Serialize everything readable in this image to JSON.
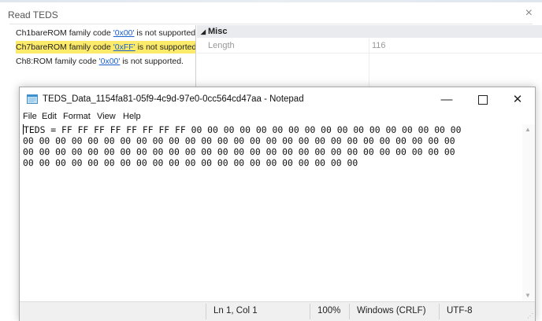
{
  "read_teds_window": {
    "title": "Read TEDS",
    "close_glyph": "×"
  },
  "messages": [
    {
      "prefix": "Ch1bareROM family code ",
      "code": "'0x00'",
      "suffix": " is not supported.",
      "selected": false
    },
    {
      "prefix": "Ch7bareROM family code ",
      "code": "'0xFF'",
      "suffix": " is not supported.",
      "selected": true
    },
    {
      "prefix": "Ch8:ROM family code ",
      "code": "'0x00'",
      "suffix": " is not supported.",
      "selected": false
    }
  ],
  "property_grid": {
    "category_arrow": "◢",
    "category": "Misc",
    "rows": [
      {
        "name": "Length",
        "value": "116"
      }
    ]
  },
  "notepad": {
    "title": "TEDS_Data_1154fa81-05f9-4c9d-97e0-0cc564cd47aa - Notepad",
    "min_glyph": "—",
    "close_glyph": "✕",
    "menu": [
      "File",
      "Edit",
      "Format",
      "View",
      "Help"
    ],
    "content_lines": [
      "TEDS = FF FF FF FF FF FF FF FF 00 00 00 00 00 00 00 00 00 00 00 00 00 00 00 00 00",
      "00 00 00 00 00 00 00 00 00 00 00 00 00 00 00 00 00 00 00 00 00 00 00 00 00 00 00",
      "00 00 00 00 00 00 00 00 00 00 00 00 00 00 00 00 00 00 00 00 00 00 00 00 00 00 00",
      "00 00 00 00 00 00 00 00 00 00 00 00 00 00 00 00 00 00 00 00 00"
    ],
    "status": {
      "position": "Ln 1, Col 1",
      "zoom": "100%",
      "line_ending": "Windows (CRLF)",
      "encoding": "UTF-8"
    },
    "icon": "notepad-icon"
  },
  "colors": {
    "selection_highlight": "#fcea6a",
    "link": "#1a5fd0"
  }
}
